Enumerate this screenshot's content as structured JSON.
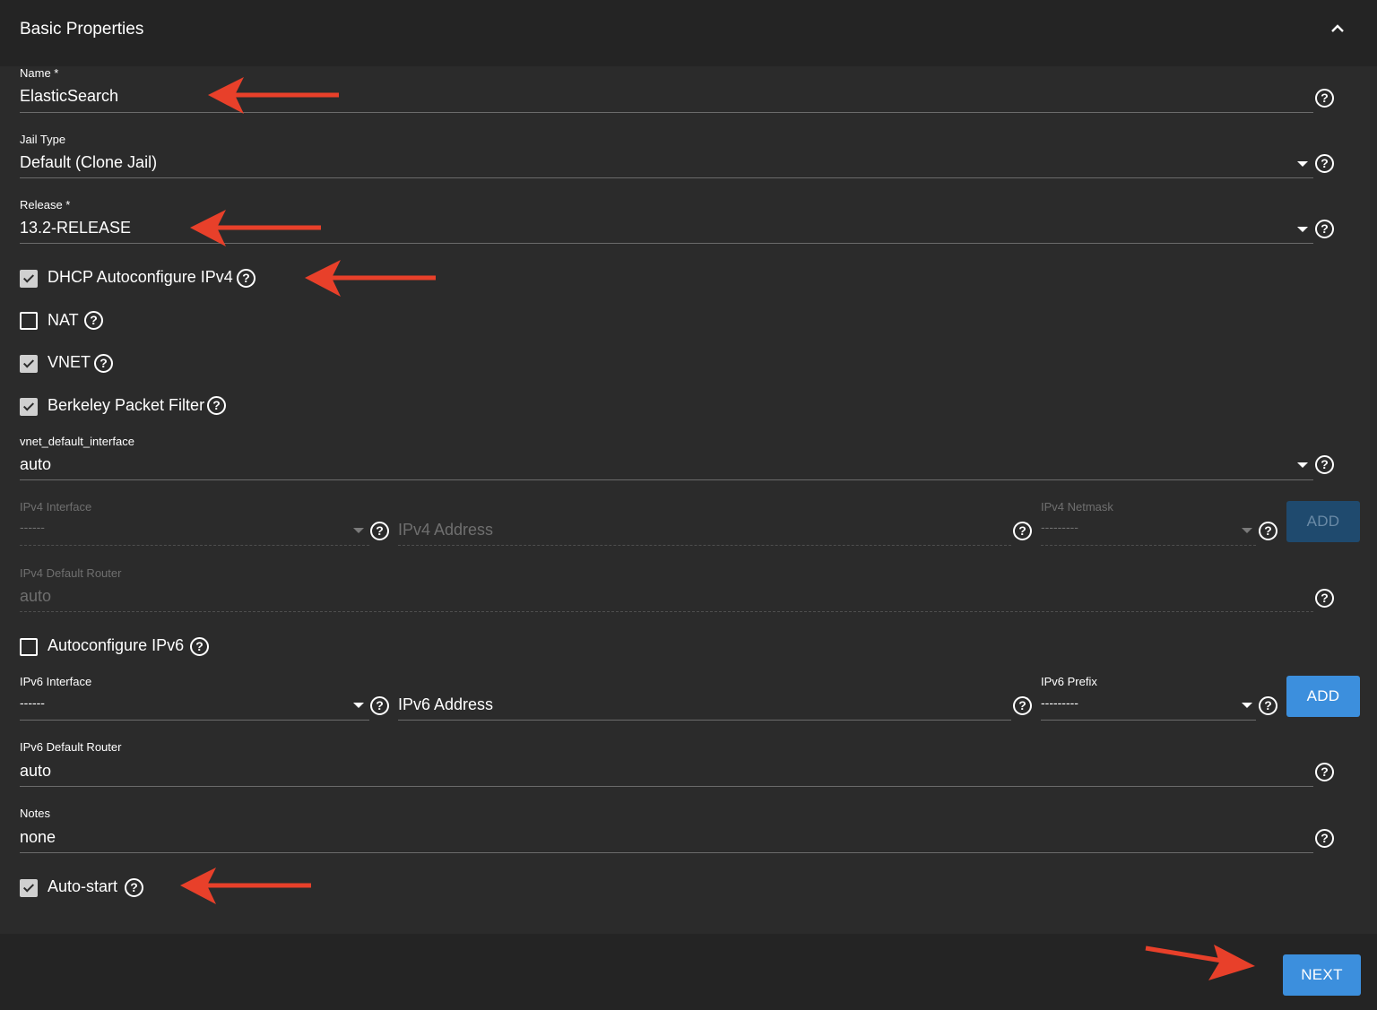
{
  "section": {
    "title": "Basic Properties",
    "collapse_icon": "chevron-up-icon"
  },
  "fields": {
    "name": {
      "label": "Name *",
      "value": "ElasticSearch"
    },
    "jail_type": {
      "label": "Jail Type",
      "value": "Default (Clone Jail)"
    },
    "release": {
      "label": "Release *",
      "value": "13.2-RELEASE"
    },
    "vnet_default_interface": {
      "label": "vnet_default_interface",
      "value": "auto"
    },
    "ipv4_interface": {
      "label": "IPv4 Interface",
      "value": "------"
    },
    "ipv4_address": {
      "placeholder": "IPv4 Address"
    },
    "ipv4_netmask": {
      "label": "IPv4 Netmask",
      "value": "---------"
    },
    "ipv4_default_router": {
      "label": "IPv4 Default Router",
      "value": "auto"
    },
    "ipv6_interface": {
      "label": "IPv6 Interface",
      "value": "------"
    },
    "ipv6_address": {
      "placeholder": "IPv6 Address"
    },
    "ipv6_prefix": {
      "label": "IPv6 Prefix",
      "value": "---------"
    },
    "ipv6_default_router": {
      "label": "IPv6 Default Router",
      "value": "auto"
    },
    "notes": {
      "label": "Notes",
      "value": "none"
    }
  },
  "checkboxes": {
    "dhcp": {
      "label": "DHCP Autoconfigure IPv4",
      "checked": true
    },
    "nat": {
      "label": "NAT",
      "checked": false
    },
    "vnet": {
      "label": "VNET",
      "checked": true
    },
    "bpf": {
      "label": "Berkeley Packet Filter",
      "checked": true
    },
    "autoconf_ipv6": {
      "label": "Autoconfigure IPv6",
      "checked": false
    },
    "autostart": {
      "label": "Auto-start",
      "checked": true
    }
  },
  "buttons": {
    "add_ipv4": "ADD",
    "add_ipv6": "ADD",
    "next": "NEXT"
  },
  "help_glyph": "?",
  "colors": {
    "accent": "#3c8fdd",
    "background": "#2b2b2b",
    "annotation_arrow": "#e8402a"
  }
}
